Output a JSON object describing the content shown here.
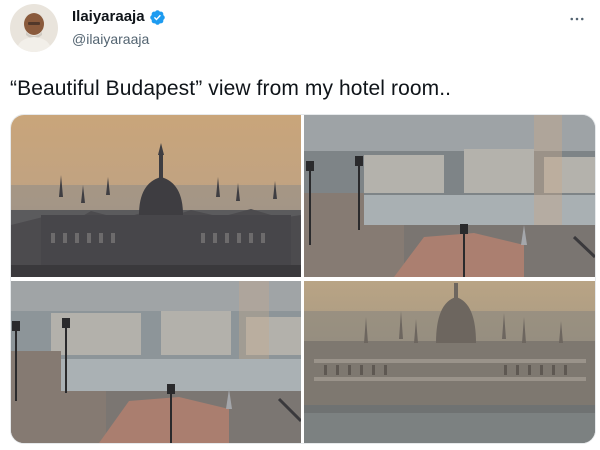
{
  "tweet": {
    "author": {
      "display_name": "Ilaiyaraaja",
      "handle": "@ilaiyaraaja",
      "verified": true,
      "verified_icon": "verified-badge-icon",
      "verified_color": "#1d9bf0"
    },
    "more_icon": "more-options-icon",
    "text": "“Beautiful Budapest” view from my hotel room..",
    "media": [
      {
        "icon": "photo-parliament-dome-sunrise"
      },
      {
        "icon": "photo-danube-lamps-city"
      },
      {
        "icon": "photo-danube-lamps-city-alt"
      },
      {
        "icon": "photo-parliament-riverside"
      }
    ]
  },
  "colors": {
    "text": "#0f1419",
    "secondary": "#536471",
    "accent": "#1d9bf0"
  }
}
